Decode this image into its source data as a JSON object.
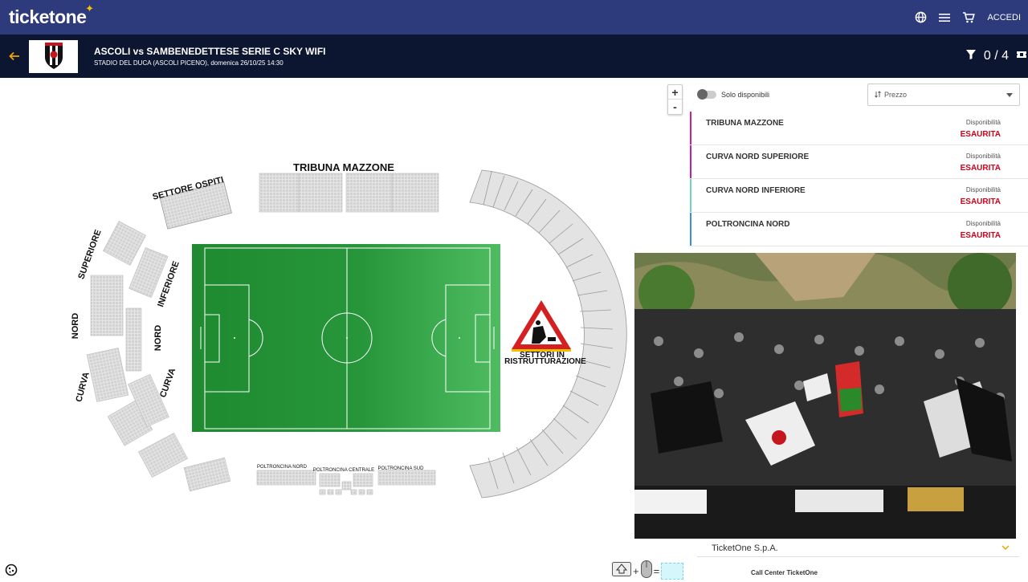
{
  "header": {
    "brand": "ticketone",
    "brand_star": "✦",
    "login_label": "ACCEDI"
  },
  "event": {
    "title": "ASCOLI vs SAMBENEDETTESE SERIE C SKY WIFI",
    "subtitle": "STADIO DEL DUCA (ASCOLI PICENO), domenica 26/10/25 14:30",
    "cart_count": "0 / 4"
  },
  "map": {
    "labels": {
      "tribuna": "TRIBUNA MAZZONE",
      "ospiti": "SETTORE OSPITI",
      "superiore": "SUPERIORE",
      "inferiore": "INFERIORE",
      "nord1": "NORD",
      "nord2": "NORD",
      "curva1": "CURVA",
      "curva2": "CURVA",
      "works1": "SETTORI IN",
      "works2": "RISTRUTTURAZIONE",
      "poltroncina_nord": "POLTRONCINA NORD",
      "poltroncina_centrale": "POLTRONCINA CENTRALE",
      "poltroncina_sud": "POLTRONCINA SUD"
    }
  },
  "zoom": {
    "in": "+",
    "out": "-"
  },
  "filters": {
    "only_available": "Solo disponibili",
    "sort_value": "Prezzo"
  },
  "sectors": [
    {
      "name": "TRIBUNA MAZZONE",
      "availability_label": "Disponibilità",
      "status": "ESAURITA",
      "color": "#d41e8a"
    },
    {
      "name": "CURVA NORD SUPERIORE",
      "availability_label": "Disponibilità",
      "status": "ESAURITA",
      "color": "#c11fa8"
    },
    {
      "name": "CURVA NORD INFERIORE",
      "availability_label": "Disponibilità",
      "status": "ESAURITA",
      "color": "#6fd4c4"
    },
    {
      "name": "POLTRONCINA NORD",
      "availability_label": "Disponibilità",
      "status": "ESAURITA",
      "color": "#3a8ee0"
    }
  ],
  "footer": {
    "company": "TicketOne S.p.A.",
    "call_center": "Call Center TicketOne"
  },
  "colors": {
    "nav": "#2d3a7c",
    "event_bar": "#0d1631",
    "accent": "#f0a500",
    "sold_out": "#d0021b",
    "pitch": "#2e9a3e"
  },
  "icons": [
    "globe-icon",
    "menu-icon",
    "cart-icon",
    "back-arrow-icon",
    "filter-icon",
    "ticket-icon",
    "sort-icon",
    "chevron-down-icon",
    "cookie-icon"
  ]
}
